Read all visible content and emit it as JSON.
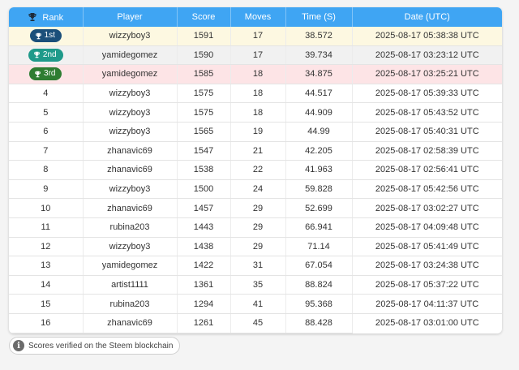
{
  "table": {
    "headers": {
      "rank": "Rank",
      "player": "Player",
      "score": "Score",
      "moves": "Moves",
      "time": "Time (S)",
      "date": "Date (UTC)"
    },
    "rows": [
      {
        "rank": "1st",
        "player": "wizzyboy3",
        "score": "1591",
        "moves": "17",
        "time": "38.572",
        "date": "2025-08-17 05:38:38 UTC"
      },
      {
        "rank": "2nd",
        "player": "yamidegomez",
        "score": "1590",
        "moves": "17",
        "time": "39.734",
        "date": "2025-08-17 03:23:12 UTC"
      },
      {
        "rank": "3rd",
        "player": "yamidegomez",
        "score": "1585",
        "moves": "18",
        "time": "34.875",
        "date": "2025-08-17 03:25:21 UTC"
      },
      {
        "rank": "4",
        "player": "wizzyboy3",
        "score": "1575",
        "moves": "18",
        "time": "44.517",
        "date": "2025-08-17 05:39:33 UTC"
      },
      {
        "rank": "5",
        "player": "wizzyboy3",
        "score": "1575",
        "moves": "18",
        "time": "44.909",
        "date": "2025-08-17 05:43:52 UTC"
      },
      {
        "rank": "6",
        "player": "wizzyboy3",
        "score": "1565",
        "moves": "19",
        "time": "44.99",
        "date": "2025-08-17 05:40:31 UTC"
      },
      {
        "rank": "7",
        "player": "zhanavic69",
        "score": "1547",
        "moves": "21",
        "time": "42.205",
        "date": "2025-08-17 02:58:39 UTC"
      },
      {
        "rank": "8",
        "player": "zhanavic69",
        "score": "1538",
        "moves": "22",
        "time": "41.963",
        "date": "2025-08-17 02:56:41 UTC"
      },
      {
        "rank": "9",
        "player": "wizzyboy3",
        "score": "1500",
        "moves": "24",
        "time": "59.828",
        "date": "2025-08-17 05:42:56 UTC"
      },
      {
        "rank": "10",
        "player": "zhanavic69",
        "score": "1457",
        "moves": "29",
        "time": "52.699",
        "date": "2025-08-17 03:02:27 UTC"
      },
      {
        "rank": "11",
        "player": "rubina203",
        "score": "1443",
        "moves": "29",
        "time": "66.941",
        "date": "2025-08-17 04:09:48 UTC"
      },
      {
        "rank": "12",
        "player": "wizzyboy3",
        "score": "1438",
        "moves": "29",
        "time": "71.14",
        "date": "2025-08-17 05:41:49 UTC"
      },
      {
        "rank": "13",
        "player": "yamidegomez",
        "score": "1422",
        "moves": "31",
        "time": "67.054",
        "date": "2025-08-17 03:24:38 UTC"
      },
      {
        "rank": "14",
        "player": "artist1111",
        "score": "1361",
        "moves": "35",
        "time": "88.824",
        "date": "2025-08-17 05:37:22 UTC"
      },
      {
        "rank": "15",
        "player": "rubina203",
        "score": "1294",
        "moves": "41",
        "time": "95.368",
        "date": "2025-08-17 04:11:37 UTC"
      },
      {
        "rank": "16",
        "player": "zhanavic69",
        "score": "1261",
        "moves": "45",
        "time": "88.428",
        "date": "2025-08-17 03:01:00 UTC"
      }
    ]
  },
  "footer": {
    "note": "Scores verified on the Steem blockchain",
    "icon": "info-icon"
  },
  "colors": {
    "header_bg": "#3fa5f3",
    "gold_row_bg": "#fdf8e1",
    "silver_row_bg": "#f1f1f1",
    "bronze_row_bg": "#fde4e6",
    "gold_badge": "#1b4f7a",
    "silver_badge": "#1f9a8a",
    "bronze_badge": "#2e7d32"
  }
}
